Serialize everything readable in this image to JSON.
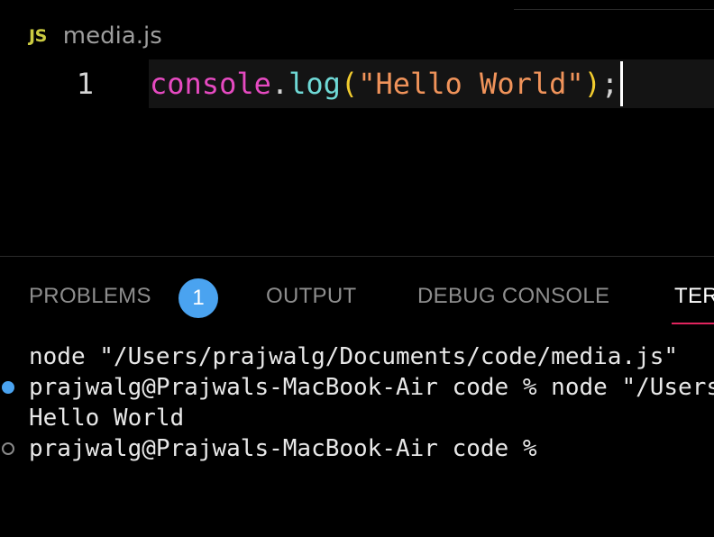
{
  "editor": {
    "tab": {
      "icon": "JS",
      "icon_name": "javascript-file-icon",
      "title": "media.js"
    },
    "lines": [
      {
        "number": "1",
        "tokens": {
          "object": "console",
          "dot": ".",
          "method": "log",
          "open_paren": "(",
          "string": "\"Hello World\"",
          "close_paren": ")",
          "semicolon": ";"
        }
      }
    ],
    "colors": {
      "object": "#e64ac1",
      "method": "#6fd9d6",
      "paren": "#f2cc2e",
      "string": "#f0935a",
      "js_icon": "#cbcb41"
    }
  },
  "panel": {
    "tabs": [
      {
        "label": "PROBLEMS",
        "badge": "1"
      },
      {
        "label": "OUTPUT"
      },
      {
        "label": "DEBUG CONSOLE"
      },
      {
        "label": "TERMINAL",
        "active": true
      }
    ],
    "badge_color": "#4aa3f0",
    "active_underline_color": "#e0245e"
  },
  "terminal": {
    "lines": [
      {
        "text": "node \"/Users/prajwalg/Documents/code/media.js\"",
        "marker": "none"
      },
      {
        "text": "prajwalg@Prajwals-MacBook-Air code % node \"/Users/prajwalg/Documents/code/media.js\"",
        "marker": "success-dot"
      },
      {
        "text": "Hello World",
        "marker": "none"
      },
      {
        "text": "prajwalg@Prajwals-MacBook-Air code % ",
        "marker": "empty-dot"
      }
    ]
  }
}
